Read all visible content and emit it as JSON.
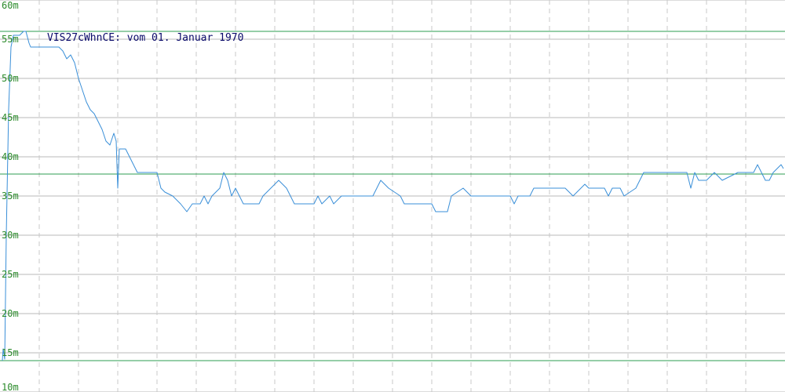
{
  "chart_data": {
    "type": "line",
    "title": "VIS27cWhnCE: vom 01. Januar 1970",
    "xlabel": "",
    "ylabel": "",
    "xlim": [
      0,
      100
    ],
    "ylim": [
      10,
      60
    ],
    "y_ticks": [
      10,
      15,
      20,
      25,
      30,
      35,
      40,
      45,
      50,
      55,
      60
    ],
    "y_tick_labels": [
      "10m",
      "15m",
      "20m",
      "25m",
      "30m",
      "35m",
      "40m",
      "45m",
      "50m",
      "55m",
      "60m"
    ],
    "x_grid": [
      5,
      10,
      15,
      20,
      25,
      30,
      35,
      40,
      45,
      50,
      55,
      60,
      65,
      70,
      75,
      80,
      85,
      90,
      95
    ],
    "grid": true,
    "reference_lines": [
      56,
      37.8,
      14
    ],
    "colors": {
      "series": "#3a8fd8",
      "reference": "#2e9e50",
      "grid_h": "#b8b8b8",
      "grid_v": "#c8c8c8",
      "tick_label": "#2a8a2a",
      "title": "#0a0a6a"
    },
    "series": [
      {
        "points": [
          [
            0.3,
            14
          ],
          [
            0.4,
            15.5
          ],
          [
            0.6,
            14.2
          ],
          [
            0.8,
            30
          ],
          [
            1.1,
            46
          ],
          [
            1.4,
            54
          ],
          [
            1.7,
            55.5
          ],
          [
            2.5,
            55.5
          ],
          [
            3.0,
            56
          ],
          [
            3.3,
            56
          ],
          [
            3.7,
            54.5
          ],
          [
            3.9,
            54
          ],
          [
            7.5,
            54
          ],
          [
            8.0,
            53.5
          ],
          [
            8.5,
            52.5
          ],
          [
            9.0,
            53
          ],
          [
            9.5,
            52
          ],
          [
            10.0,
            50
          ],
          [
            10.5,
            48.5
          ],
          [
            11.0,
            47
          ],
          [
            11.5,
            46
          ],
          [
            12.0,
            45.5
          ],
          [
            12.5,
            44.5
          ],
          [
            13.0,
            43.5
          ],
          [
            13.5,
            42
          ],
          [
            14.0,
            41.5
          ],
          [
            14.5,
            43
          ],
          [
            14.8,
            42
          ],
          [
            15.0,
            36
          ],
          [
            15.2,
            41
          ],
          [
            16.0,
            41
          ],
          [
            16.5,
            40
          ],
          [
            17.0,
            39
          ],
          [
            17.5,
            38
          ],
          [
            20.0,
            38
          ],
          [
            20.5,
            36
          ],
          [
            21.0,
            35.5
          ],
          [
            22.0,
            35
          ],
          [
            23.0,
            34
          ],
          [
            23.8,
            33
          ],
          [
            24.5,
            34
          ],
          [
            25.5,
            34
          ],
          [
            26.0,
            35
          ],
          [
            26.5,
            34
          ],
          [
            27.0,
            35
          ],
          [
            28.0,
            36
          ],
          [
            28.5,
            38
          ],
          [
            29.0,
            37
          ],
          [
            29.5,
            35
          ],
          [
            30.0,
            36
          ],
          [
            31.0,
            34
          ],
          [
            33.0,
            34
          ],
          [
            33.5,
            35
          ],
          [
            34.5,
            36
          ],
          [
            35.5,
            37
          ],
          [
            36.5,
            36
          ],
          [
            37.5,
            34
          ],
          [
            40.0,
            34
          ],
          [
            40.5,
            35
          ],
          [
            41.0,
            34
          ],
          [
            42.0,
            35
          ],
          [
            42.5,
            34
          ],
          [
            43.5,
            35
          ],
          [
            47.5,
            35
          ],
          [
            48.5,
            37
          ],
          [
            49.5,
            36
          ],
          [
            51.0,
            35
          ],
          [
            51.5,
            34
          ],
          [
            52.5,
            34
          ],
          [
            55.0,
            34
          ],
          [
            55.5,
            33
          ],
          [
            57.0,
            33
          ],
          [
            57.5,
            35
          ],
          [
            59.0,
            36
          ],
          [
            60.0,
            35
          ],
          [
            65.0,
            35
          ],
          [
            65.5,
            34
          ],
          [
            66.0,
            35
          ],
          [
            67.5,
            35
          ],
          [
            68.0,
            36
          ],
          [
            72.0,
            36
          ],
          [
            73.0,
            35
          ],
          [
            74.0,
            36
          ],
          [
            74.5,
            36.5
          ],
          [
            75.0,
            36
          ],
          [
            77.0,
            36
          ],
          [
            77.5,
            35
          ],
          [
            78.0,
            36
          ],
          [
            79.0,
            36
          ],
          [
            79.5,
            35
          ],
          [
            81.0,
            36
          ],
          [
            81.5,
            37
          ],
          [
            82.0,
            38
          ],
          [
            87.5,
            38
          ],
          [
            88.0,
            36
          ],
          [
            88.5,
            38
          ],
          [
            89.0,
            37
          ],
          [
            90.0,
            37
          ],
          [
            91.0,
            38
          ],
          [
            92.0,
            37
          ],
          [
            94.0,
            38
          ],
          [
            96.0,
            38
          ],
          [
            96.5,
            39
          ],
          [
            97.0,
            38
          ],
          [
            97.5,
            37
          ],
          [
            98.0,
            37
          ],
          [
            98.5,
            38
          ],
          [
            99.5,
            39
          ],
          [
            99.8,
            38.5
          ]
        ]
      }
    ]
  }
}
